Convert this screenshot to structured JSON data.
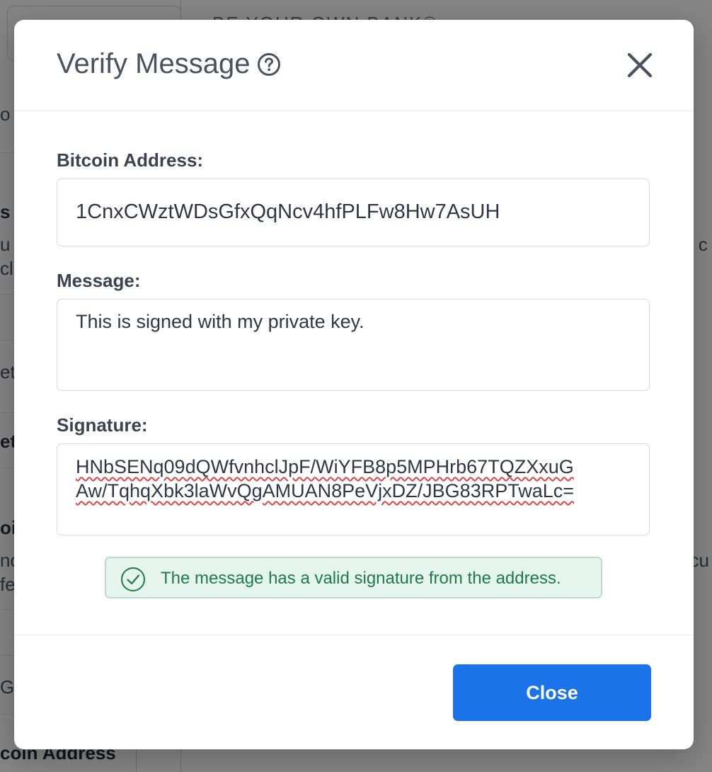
{
  "background": {
    "tagline": "BE YOUR OWN BANK®",
    "coin_address_label": "coin Address",
    "fragments": [
      "o",
      "s",
      "u t",
      "cli",
      "et",
      "et",
      "oi",
      "nd",
      "fe",
      "Gf",
      "ll c",
      "ecu"
    ]
  },
  "modal": {
    "title": "Verify Message",
    "help_icon": "question-circle-icon",
    "close_icon": "close-x-icon",
    "address_label": "Bitcoin Address:",
    "address_value": "1CnxCWztWDsGfxQqNcv4hfPLFw8Hw7AsUH",
    "message_label": "Message:",
    "message_value": "This is signed with my private key.",
    "signature_label": "Signature:",
    "signature_lines": [
      "HNbSENq09dQWfvnhclJpF/WiYFB8p5MPHrb67TQZXxuG",
      "Aw/TqhqXbk3laWvQgAMUAN8PeVjxDZ/JBG83RPTwaLc="
    ],
    "status_icon": "check-circle-icon",
    "status_text": "The message has a valid signature from the address.",
    "close_button": "Close"
  },
  "colors": {
    "primary": "#1a73e8",
    "success_text": "#1d7a50",
    "success_bg": "#e6f4ee"
  }
}
